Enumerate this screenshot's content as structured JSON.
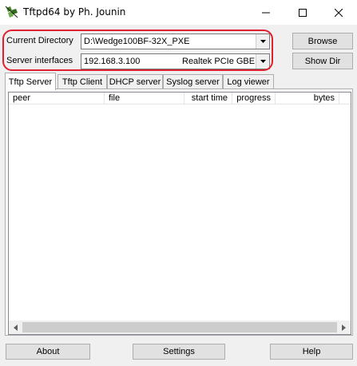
{
  "window": {
    "title": "Tftpd64 by Ph. Jounin"
  },
  "settings": {
    "current_directory_label": "Current Directory",
    "current_directory_value": "D:\\Wedge100BF-32X_PXE",
    "server_interfaces_label": "Server interfaces",
    "server_ip": "192.168.3.100",
    "server_adapter": "Realtek PCIe GBE I"
  },
  "buttons": {
    "browse": "Browse",
    "show_dir": "Show Dir",
    "about": "About",
    "settings": "Settings",
    "help": "Help"
  },
  "tabs": [
    {
      "label": "Tftp Server",
      "active": true
    },
    {
      "label": "Tftp Client",
      "active": false
    },
    {
      "label": "DHCP server",
      "active": false
    },
    {
      "label": "Syslog server",
      "active": false
    },
    {
      "label": "Log viewer",
      "active": false
    }
  ],
  "table": {
    "columns": [
      "peer",
      "file",
      "start time",
      "progress",
      "bytes"
    ],
    "rows": []
  },
  "colors": {
    "highlight": "#e0202e"
  }
}
